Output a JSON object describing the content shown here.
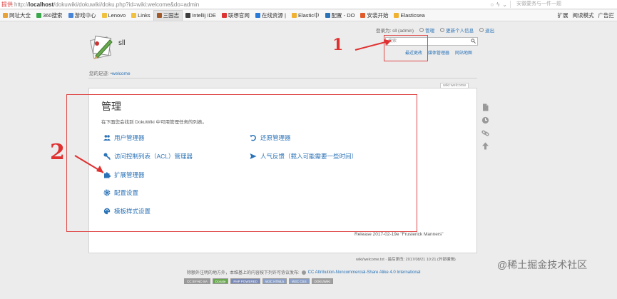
{
  "browser": {
    "url_prefix": "提供",
    "url_scheme": "http://",
    "url_host": "localhost",
    "url_path": "/dokuwiki/dokuwiki/doku.php?id=wiki:welcome&do=admin",
    "search_placeholder": "安徽要务与一件一题"
  },
  "bookmarks": [
    {
      "label": "网址大全",
      "color": "#e8a23a"
    },
    {
      "label": "360搜索",
      "color": "#3aa84a"
    },
    {
      "label": "游戏中心",
      "color": "#4a86d8"
    },
    {
      "label": "Lenovo",
      "color": "#f0c040"
    },
    {
      "label": "Links",
      "color": "#f0c040"
    },
    {
      "label": "三国志",
      "color": "#a05a2a"
    },
    {
      "label": "Intellij IDE",
      "color": "#3c3c3c"
    },
    {
      "label": "联想官网",
      "color": "#d33"
    },
    {
      "label": "在线资源 |",
      "color": "#2a7ad8"
    },
    {
      "label": "Elastic中",
      "color": "#f0b030"
    },
    {
      "label": "配置 - DO",
      "color": "#2b73b7"
    },
    {
      "label": "安装开始",
      "color": "#e05a2a"
    },
    {
      "label": "Elasticsea",
      "color": "#f0b030"
    }
  ],
  "bookmarks_right": [
    "扩展",
    "阅读模式",
    "广告拦"
  ],
  "site": {
    "title": "sll",
    "user_label": "登录为: sll (admin)",
    "admin_link": "管理",
    "profile_link": "更新个人信息",
    "logout_link": "退出",
    "search_placeholder": "搜索",
    "recent_changes": "最近更改",
    "media_manager": "媒体管理器",
    "sitemap": "网站地图",
    "trace_label": "您的足迹:",
    "trace_link": "welcome",
    "page_tag": "wiki:welcome"
  },
  "admin": {
    "title": "管理",
    "description": "在下面您会找到 DokuWiki 中可用管理任务的列表。",
    "items": [
      {
        "label": "用户管理器"
      },
      {
        "label": "访问控制列表（ACL）管理器"
      },
      {
        "label": "扩展管理器"
      },
      {
        "label": "配置设置"
      },
      {
        "label": "模板样式设置"
      }
    ],
    "items_right": [
      {
        "label": "还原管理器"
      },
      {
        "label": "人气反馈（载入可能需要一些时间）"
      }
    ],
    "release": "Release 2017-02-19e \"Frusterick Manners\""
  },
  "footer": {
    "page_info": "wiki/welcome.txt · 最后更改: 2017/08/21 10:21 (外部编辑)",
    "license_text": "除额外注明的地方外，本维基上的内容按下列许可协议发布:",
    "license_link": "CC Attribution-Noncommercial-Share Alike 4.0 International",
    "badges": [
      "CC BY-NC-SA",
      "Donate",
      "PHP POWERED",
      "W3C HTML5",
      "W3C CSS",
      "DOKUWIKI"
    ]
  },
  "annotations": {
    "one": "1",
    "two": "2"
  },
  "watermark": "@稀土掘金技术社区",
  "colors": {
    "link": "#2b73b7",
    "annotation": "#e04848"
  }
}
